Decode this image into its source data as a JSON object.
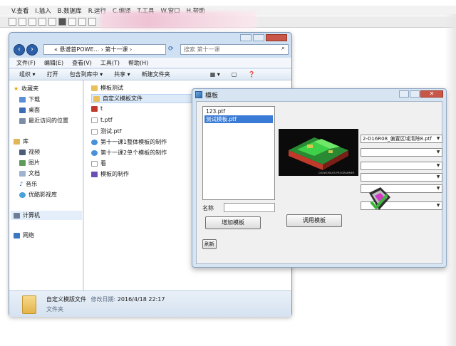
{
  "app": {
    "menubar": [
      "V.查看",
      "I.插入",
      "B.数据库",
      "R.运行",
      "C.编译",
      "T.工具",
      "W.窗口",
      "H.帮助"
    ]
  },
  "explorer": {
    "address_path": "« 悬谱首POWE... › 第十一课 ›",
    "search_placeholder": "搜索 第十一课",
    "menubar": [
      "文件(F)",
      "编辑(E)",
      "查看(V)",
      "工具(T)",
      "帮助(H)"
    ],
    "commands": [
      "组织 ▾",
      "打开",
      "包含到库中 ▾",
      "共享 ▾",
      "新建文件夹"
    ],
    "nav": {
      "favorites": "收藏夹",
      "favorites_items": [
        "下载",
        "桌面",
        "最近访问的位置"
      ],
      "libraries": "库",
      "libraries_items": [
        "视频",
        "图片",
        "文档",
        "音乐",
        "优酷影视库"
      ],
      "computer": "计算机",
      "network": "网络"
    },
    "files": [
      "模板测试",
      "自定义模板文件",
      "t",
      "t.ptf",
      "测试.ptf",
      "第十一课1整体模板的制作",
      "第十一课2单个模板的制作",
      "看",
      "模板的制作"
    ],
    "status": {
      "name": "自定义模版文件",
      "modified_label": "修改日期:",
      "modified": "2016/4/18 22:17",
      "type": "文件夹"
    }
  },
  "dialog": {
    "title": "模板",
    "list_items": [
      "123.ptf",
      "测试模板.ptf"
    ],
    "selects": [
      "2-D16R08_偏置区域清除8.ptf",
      "",
      "",
      "",
      "",
      ""
    ],
    "name_label": "名称",
    "name_value": "",
    "add_button": "增加模板",
    "apply_button": "调用模板",
    "refresh_button": "刷新",
    "preview_caption": "DIGIWORK-RS PROGRAMMER"
  }
}
